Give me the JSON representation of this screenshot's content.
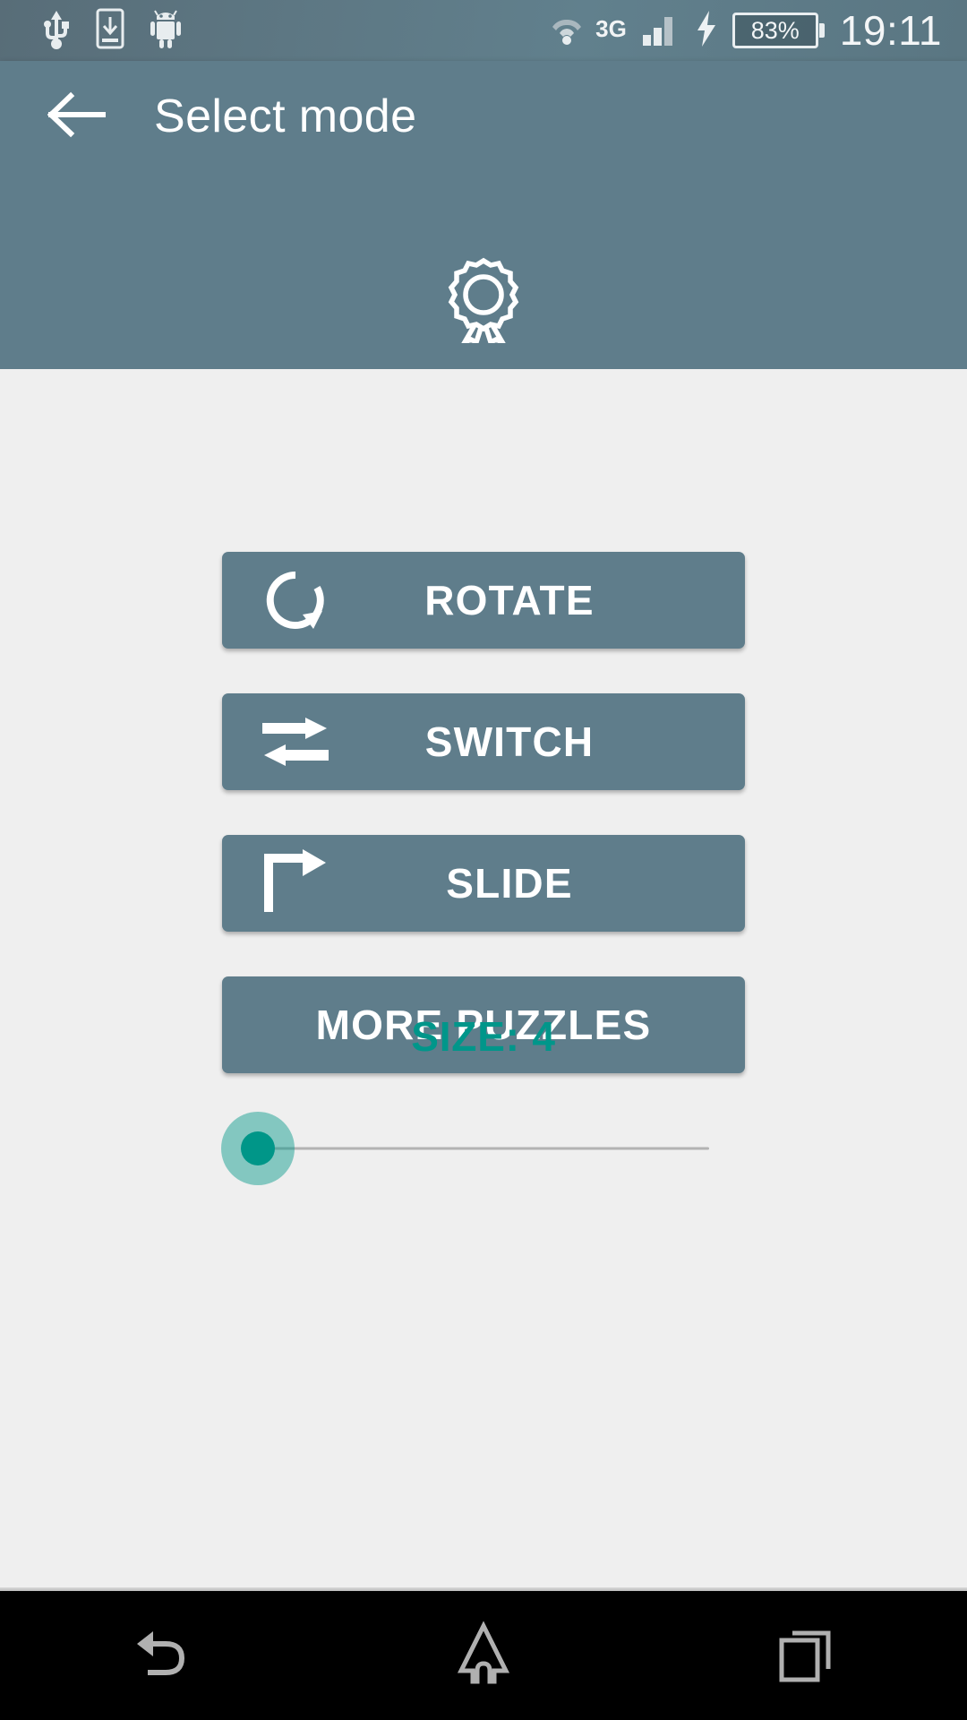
{
  "status_bar": {
    "left_icons": [
      "usb-icon",
      "download-to-device-icon",
      "android-robot-icon"
    ],
    "network_label": "3G",
    "right_icons": [
      "wifi-icon",
      "signal-bars-icon",
      "charging-bolt-icon"
    ],
    "battery_percent": "83%",
    "clock": "19:11"
  },
  "app_bar": {
    "back_icon": "arrow-left-icon",
    "title": "Select mode",
    "award_icon": "award-ribbon-icon",
    "background_color": "#5f7d8b"
  },
  "main": {
    "modes": [
      {
        "label": "ROTATE",
        "icon": "rotate-clockwise-icon"
      },
      {
        "label": "SWITCH",
        "icon": "swap-arrows-icon"
      },
      {
        "label": "SLIDE",
        "icon": "turn-right-arrow-icon"
      },
      {
        "label": "MORE PUZZLES",
        "icon": ""
      }
    ],
    "size": {
      "label": "SIZE: 4",
      "value": 4,
      "min": 4,
      "max": 10,
      "accent_color": "#009688"
    }
  },
  "nav_bar": {
    "buttons": [
      "back-nav-icon",
      "home-nav-icon",
      "recents-nav-icon"
    ]
  }
}
